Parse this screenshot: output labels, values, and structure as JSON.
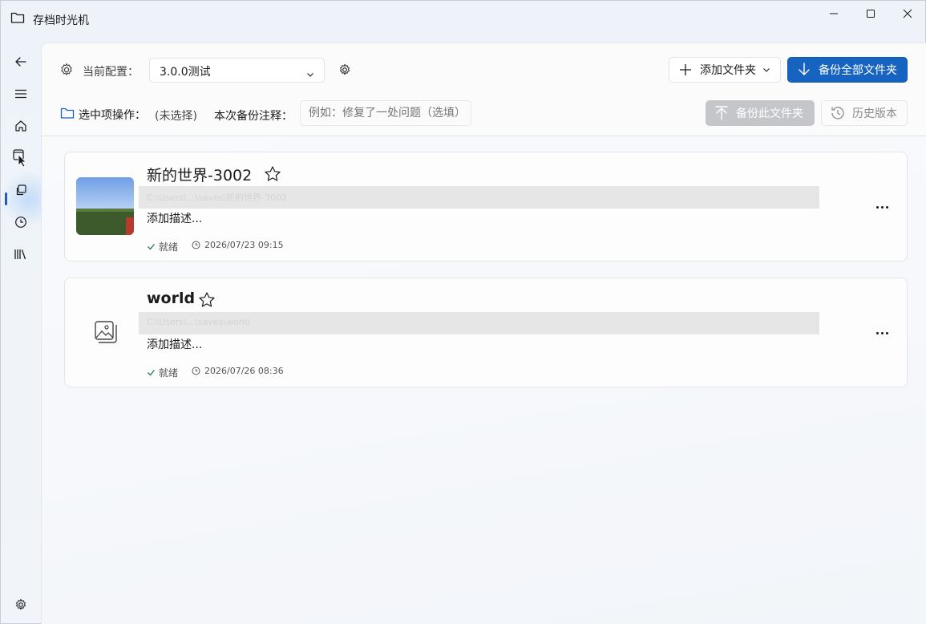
{
  "window": {
    "title": "存档时光机"
  },
  "toolbar": {
    "config_label": "当前配置：",
    "config_value": "3.0.0测试",
    "add_folder_label": "添加文件夹",
    "backup_all_label": "备份全部文件夹",
    "selected_ops_label": "选中项操作：",
    "selected_value": "(未选择)",
    "note_label": "本次备份注释：",
    "note_placeholder": "例如：修复了一处问题（选填）",
    "backup_this_label": "备份此文件夹",
    "history_label": "历史版本"
  },
  "folders": [
    {
      "name": "新的世界-3002",
      "path": "C:\\Users\\...\\saves\\新的世界-3002",
      "description": "添加描述...",
      "status": "就绪",
      "time": "2026/07/23 09:15",
      "thumbnail": "minecraft-landscape"
    },
    {
      "name": "world",
      "path": "C:\\Users\\...\\saves\\world",
      "description": "添加描述...",
      "status": "就绪",
      "time": "2026/07/26 08:36",
      "thumbnail": "image-placeholder-icon"
    }
  ],
  "colors": {
    "accent": "#1664c0",
    "disabled": "#c4c6c9",
    "status_ok": "#1f7a4d"
  }
}
